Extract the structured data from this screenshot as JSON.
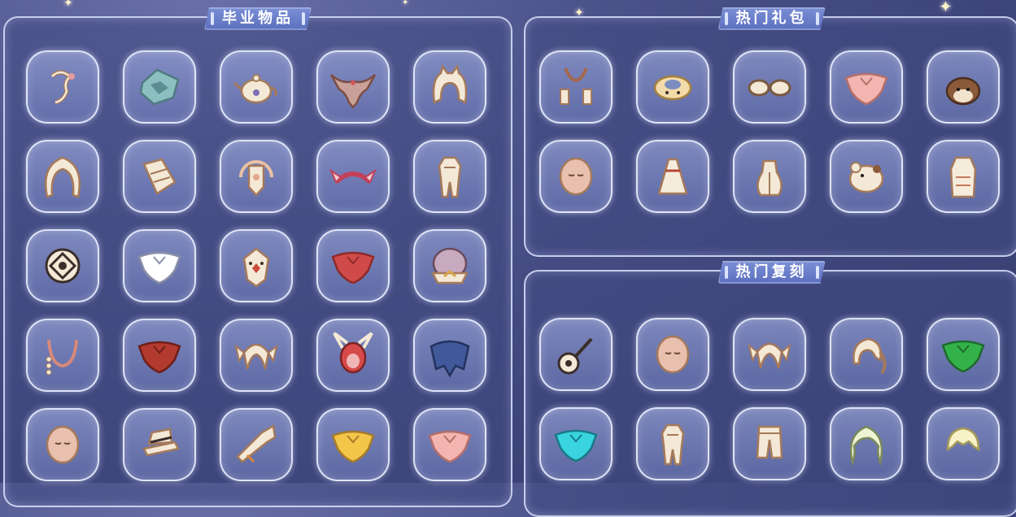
{
  "panels": {
    "graduation": {
      "title": "毕业物品",
      "items": [
        {
          "icon": "hair-accessory-icon"
        },
        {
          "icon": "rock-cape-icon"
        },
        {
          "icon": "teapot-icon"
        },
        {
          "icon": "wing-cape-icon"
        },
        {
          "icon": "hood-hair-icon"
        },
        {
          "icon": "long-hair-icon"
        },
        {
          "icon": "drum-icon"
        },
        {
          "icon": "moon-mask-icon"
        },
        {
          "icon": "horn-headband-icon"
        },
        {
          "icon": "outfit-icon"
        },
        {
          "icon": "round-shield-icon"
        },
        {
          "icon": "white-cape-icon"
        },
        {
          "icon": "tribal-mask-icon"
        },
        {
          "icon": "red-cape-icon"
        },
        {
          "icon": "bun-hair-icon"
        },
        {
          "icon": "necklace-icon"
        },
        {
          "icon": "dark-red-cape-icon"
        },
        {
          "icon": "pigtail-hair-icon"
        },
        {
          "icon": "horned-mask-icon"
        },
        {
          "icon": "blue-cape-icon"
        },
        {
          "icon": "face-mask-icon"
        },
        {
          "icon": "hat-icon"
        },
        {
          "icon": "horn-instrument-icon"
        },
        {
          "icon": "yellow-cape-icon"
        },
        {
          "icon": "pink-cape-icon"
        }
      ]
    },
    "hot_packs": {
      "title": "热门礼包",
      "items": [
        {
          "icon": "suspenders-icon"
        },
        {
          "icon": "scarf-icon"
        },
        {
          "icon": "sunglasses-icon"
        },
        {
          "icon": "pink-cape-icon"
        },
        {
          "icon": "pet-hat-icon"
        },
        {
          "icon": "face-mask-icon"
        },
        {
          "icon": "dress-icon"
        },
        {
          "icon": "skirt-icon"
        },
        {
          "icon": "plush-icon"
        },
        {
          "icon": "robe-icon"
        }
      ]
    },
    "hot_reruns": {
      "title": "热门复刻",
      "items": [
        {
          "icon": "guitar-icon"
        },
        {
          "icon": "face-mask-icon"
        },
        {
          "icon": "pigtail-hair-icon"
        },
        {
          "icon": "ponytail-hair-icon"
        },
        {
          "icon": "green-cape-icon"
        },
        {
          "icon": "cyan-cape-icon"
        },
        {
          "icon": "outfit-icon"
        },
        {
          "icon": "pants-icon"
        },
        {
          "icon": "wavy-hair-icon"
        },
        {
          "icon": "short-hair-icon"
        }
      ]
    }
  },
  "colors": {
    "background": "#3d4479",
    "title_bar": "#6a7dca",
    "item_cream": "#f4e9d6",
    "item_outline": "#a57a5a"
  }
}
